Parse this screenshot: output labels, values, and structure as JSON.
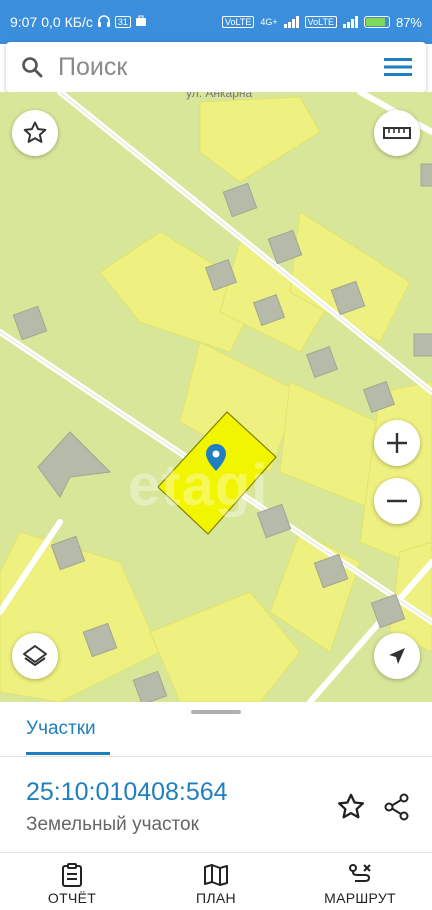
{
  "status_bar": {
    "time": "9:07",
    "speed": "0,0 КБ/с",
    "calendar_badge": "31",
    "net_label_1": "VoLTE",
    "net_label_2": "4G+",
    "net_label_3": "VoLTE",
    "battery_percent": "87%",
    "battery_level": 0.87
  },
  "search": {
    "placeholder": "Поиск"
  },
  "map": {
    "street_label": "ул. Анкарна",
    "watermark": "etagi",
    "colors": {
      "base": "#d8e69a",
      "parcel": "#eff07a",
      "selected_parcel": "#f2f500",
      "building": "#b4b8a8",
      "road": "#ffffff"
    },
    "icons": [
      "star-icon",
      "ruler-icon",
      "zoom-in-icon",
      "zoom-out-icon",
      "layers-icon",
      "my-location-icon",
      "location-pin-icon"
    ]
  },
  "sheet": {
    "tab_label": "Участки",
    "cadastral_number": "25:10:010408:564",
    "property_type": "Земельный участок"
  },
  "nav": {
    "items": [
      {
        "label": "ОТЧЁТ",
        "icon": "report-icon"
      },
      {
        "label": "ПЛАН",
        "icon": "map-icon"
      },
      {
        "label": "МАРШРУТ",
        "icon": "route-icon"
      }
    ]
  },
  "colors": {
    "accent": "#1f7fc0",
    "status_bar": "#3b8edb",
    "battery_fill": "#7dd957"
  }
}
